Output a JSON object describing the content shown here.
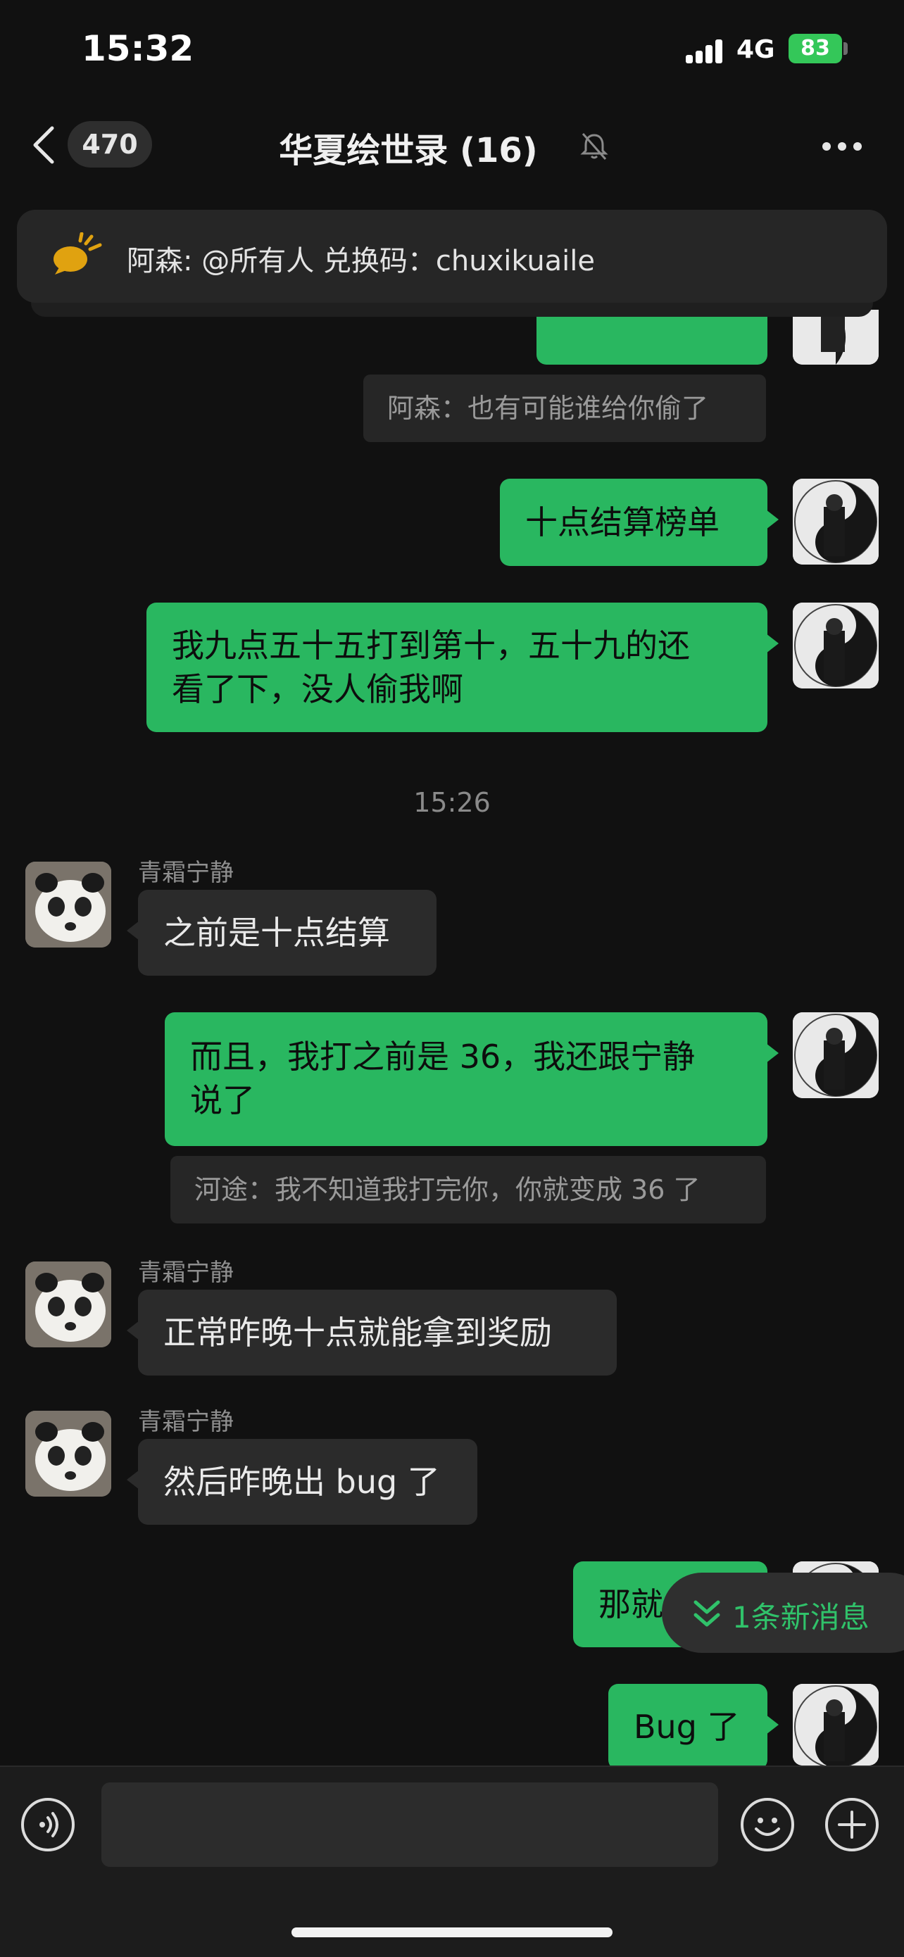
{
  "status_bar": {
    "time": "15:32",
    "network": "4G",
    "battery": "83"
  },
  "header": {
    "back_count": "470",
    "title": "华夏绘世录 (16)"
  },
  "pinned": {
    "text": "阿森: @所有人 兑换码：chuxikuaile"
  },
  "messages": {
    "quote1": "阿森：也有可能谁给你偷了",
    "m1": "十点结算榜单",
    "m2_line1": "我九点五十五打到第十，五十九的还",
    "m2_line2": "看了下，没人偷我啊",
    "time_divider": "15:26",
    "sender1": "青霜宁静",
    "m3": "之前是十点结算",
    "m4_line1": "而且，我打之前是 36，我还跟宁静",
    "m4_line2": "说了",
    "quote2": "河途：我不知道我打完你，你就变成 36 了",
    "sender2": "青霜宁静",
    "m5": "正常昨晚十点就能拿到奖励",
    "sender3": "青霜宁静",
    "m6": "然后昨晚出 bug 了",
    "m7_partial": "那就",
    "m8": "Bug 了"
  },
  "new_messages": {
    "label": "1条新消息"
  },
  "colors": {
    "my_bubble": "#29b760",
    "their_bubble": "#2b2b2b",
    "background": "#111111",
    "accent": "#30c26a"
  },
  "icons": [
    "back-chevron-icon",
    "mute-bell-icon",
    "more-icon",
    "announcement-icon",
    "double-chevron-down-icon",
    "voice-icon",
    "emoji-icon",
    "plus-icon"
  ]
}
